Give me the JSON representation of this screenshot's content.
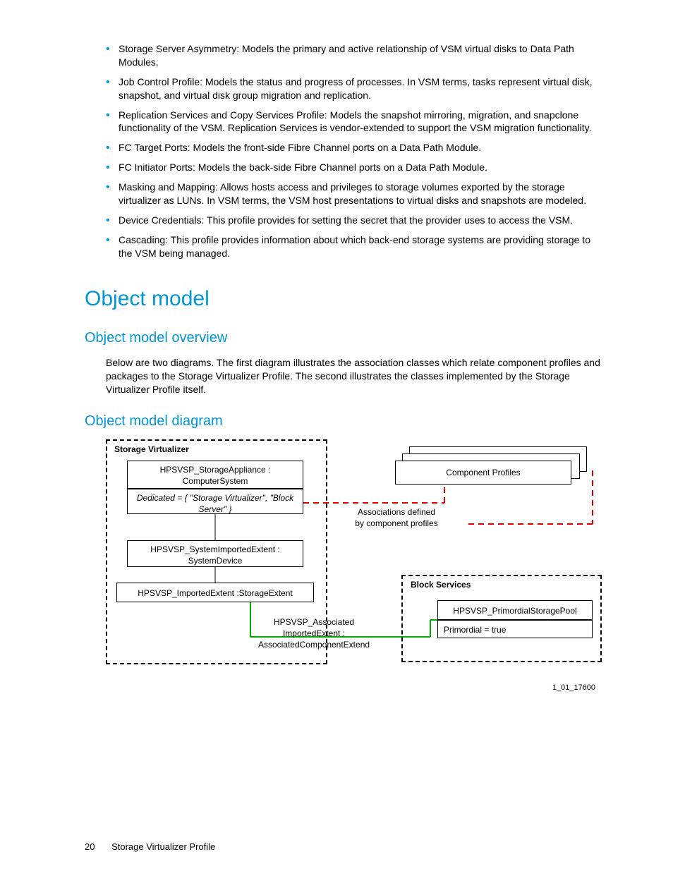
{
  "bullets": [
    "Storage Server Asymmetry: Models the primary and active relationship of VSM virtual disks to Data Path Modules.",
    "Job Control Profile: Models the status and progress of processes. In VSM terms, tasks represent virtual disk, snapshot, and virtual disk group migration and replication.",
    "Replication Services and Copy Services Profile: Models the snapshot mirroring, migration, and snapclone functionality of the VSM. Replication Services is vendor-extended to support the VSM migration functionality.",
    "FC Target Ports: Models the front-side Fibre Channel ports on a Data Path Module.",
    "FC Initiator Ports: Models the back-side Fibre Channel ports on a Data Path Module.",
    "Masking and Mapping: Allows hosts access and privileges to storage volumes exported by the storage virtualizer as LUNs. In VSM terms, the VSM host presentations to virtual disks and snapshots are modeled.",
    "Device Credentials: This profile provides for setting the secret that the provider uses to access the VSM.",
    "Cascading: This profile provides information about which back-end storage systems are providing storage to the VSM being managed."
  ],
  "h1": "Object model",
  "h2a": "Object model overview",
  "overview_text": "Below are two diagrams. The first diagram illustrates the association classes which relate component profiles and packages to the Storage Virtualizer Profile. The second illustrates the classes implemented by the Storage Virtualizer Profile itself.",
  "h2b": "Object model diagram",
  "diagram": {
    "sv_title": "Storage Virtualizer",
    "box1_l1": "HPSVSP_StorageAppliance :",
    "box1_l2": "ComputerSystem",
    "box1b": "Dedicated = {  \"Storage Virtualizer\", \"Block Server\" }",
    "assoc_l1": "Associations defined",
    "assoc_l2": "by component profiles",
    "cp_title": "Component Profiles",
    "box2_l1": "HPSVSP_SystemImportedExtent :",
    "box2_l2": "SystemDevice",
    "box3": "HPSVSP_ImportedExtent :StorageExtent",
    "assoc2_l1": "HPSVSP_Associated",
    "assoc2_l2": "ImportedExtent :",
    "assoc2_l3": "AssociatedComponentExtend",
    "bs_title": "Block Services",
    "box4": "HPSVSP_PrimordialStoragePool",
    "box4b": "Primordial = true",
    "fig_id": "1_01_17600"
  },
  "footer": {
    "page": "20",
    "title": "Storage Virtualizer Profile"
  }
}
